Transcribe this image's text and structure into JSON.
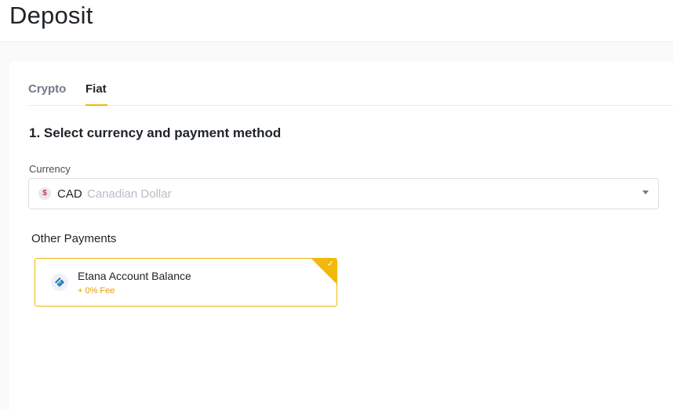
{
  "header": {
    "title": "Deposit"
  },
  "tabs": [
    {
      "label": "Crypto",
      "active": false
    },
    {
      "label": "Fiat",
      "active": true
    }
  ],
  "section": {
    "title": "1. Select currency and payment method"
  },
  "currency": {
    "label": "Currency",
    "icon_symbol": "$",
    "code": "CAD",
    "name": "Canadian Dollar"
  },
  "other_payments": {
    "title": "Other Payments",
    "options": [
      {
        "name": "Etana Account Balance",
        "fee": "+ 0% Fee",
        "selected": true,
        "icon": "etana-logo-icon"
      }
    ]
  },
  "colors": {
    "accent": "#f0b90b",
    "fee_text": "#e0a100",
    "text_primary": "#1e2329",
    "text_secondary": "#707a8a",
    "placeholder": "#b7bdc6"
  }
}
